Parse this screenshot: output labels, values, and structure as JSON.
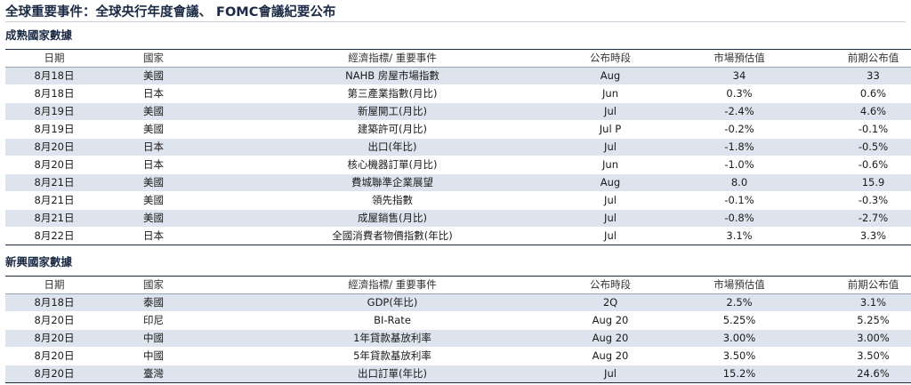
{
  "title": "全球重要事件：全球央行年度會議、 FOMC會議紀要公布",
  "columns": [
    "日期",
    "國家",
    "經濟指標/ 重要事件",
    "公布時段",
    "市場預估值",
    "前期公布值"
  ],
  "mature": {
    "title": "成熟國家數據",
    "rows": [
      [
        "8月18日",
        "美國",
        "NAHB 房屋市場指數",
        "Aug",
        "34",
        "33"
      ],
      [
        "8月18日",
        "日本",
        "第三產業指數(月比)",
        "Jun",
        "0.3%",
        "0.6%"
      ],
      [
        "8月19日",
        "美國",
        "新屋開工(月比)",
        "Jul",
        "-2.4%",
        "4.6%"
      ],
      [
        "8月19日",
        "美國",
        "建築許可(月比)",
        "Jul P",
        "-0.2%",
        "-0.1%"
      ],
      [
        "8月20日",
        "日本",
        "出口(年比)",
        "Jul",
        "-1.8%",
        "-0.5%"
      ],
      [
        "8月20日",
        "日本",
        "核心機器訂單(月比)",
        "Jun",
        "-1.0%",
        "-0.6%"
      ],
      [
        "8月21日",
        "美國",
        "費城聯準企業展望",
        "Aug",
        "8.0",
        "15.9"
      ],
      [
        "8月21日",
        "美國",
        "領先指數",
        "Jul",
        "-0.1%",
        "-0.3%"
      ],
      [
        "8月21日",
        "美國",
        "成屋銷售(月比)",
        "Jul",
        "-0.8%",
        "-2.7%"
      ],
      [
        "8月22日",
        "日本",
        "全國消費者物價指數(年比)",
        "Jul",
        "3.1%",
        "3.3%"
      ]
    ]
  },
  "emerging": {
    "title": "新興國家數據",
    "rows": [
      [
        "8月18日",
        "泰國",
        "GDP(年比)",
        "2Q",
        "2.5%",
        "3.1%"
      ],
      [
        "8月20日",
        "印尼",
        "BI-Rate",
        "Aug 20",
        "5.25%",
        "5.25%"
      ],
      [
        "8月20日",
        "中國",
        "1年貸款基放利率",
        "Aug 20",
        "3.00%",
        "3.00%"
      ],
      [
        "8月20日",
        "中國",
        "5年貸款基放利率",
        "Aug 20",
        "3.50%",
        "3.50%"
      ],
      [
        "8月20日",
        "臺灣",
        "出口訂單(年比)",
        "Jul",
        "15.2%",
        "24.6%"
      ]
    ]
  }
}
